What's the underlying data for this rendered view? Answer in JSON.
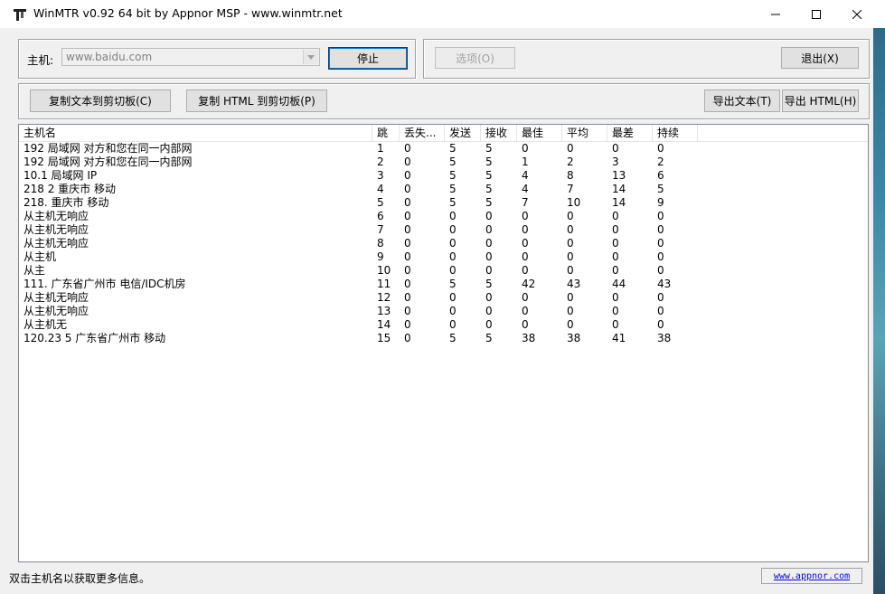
{
  "window": {
    "title": "WinMTR v0.92 64 bit by Appnor MSP - www.winmtr.net"
  },
  "host": {
    "label": "主机:",
    "value": "www.baidu.com"
  },
  "buttons": {
    "stop": "停止",
    "options": "选项(O)",
    "exit": "退出(X)",
    "copy_text": "复制文本到剪切板(C)",
    "copy_html": "复制 HTML 到剪切板(P)",
    "export_text": "导出文本(T)",
    "export_html": "导出 HTML(H)"
  },
  "table": {
    "columns": [
      "主机名",
      "跳",
      "丢失...",
      "发送",
      "接收",
      "最佳",
      "平均",
      "最差",
      "持续"
    ],
    "rows": [
      {
        "host": "192         局域网 对方和您在同一内部网",
        "hop": "1",
        "loss": "0",
        "sent": "5",
        "recv": "5",
        "best": "0",
        "avg": "0",
        "worst": "0",
        "last": "0"
      },
      {
        "host": "192         局域网 对方和您在同一内部网",
        "hop": "2",
        "loss": "0",
        "sent": "5",
        "recv": "5",
        "best": "1",
        "avg": "2",
        "worst": "3",
        "last": "2"
      },
      {
        "host": "10.1       局域网 IP",
        "hop": "3",
        "loss": "0",
        "sent": "5",
        "recv": "5",
        "best": "4",
        "avg": "8",
        "worst": "13",
        "last": "6"
      },
      {
        "host": "218          2 重庆市 移动",
        "hop": "4",
        "loss": "0",
        "sent": "5",
        "recv": "5",
        "best": "4",
        "avg": "7",
        "worst": "14",
        "last": "5"
      },
      {
        "host": "218.         重庆市 移动",
        "hop": "5",
        "loss": "0",
        "sent": "5",
        "recv": "5",
        "best": "7",
        "avg": "10",
        "worst": "14",
        "last": "9"
      },
      {
        "host": "从主机无响应",
        "hop": "6",
        "loss": "0",
        "sent": "0",
        "recv": "0",
        "best": "0",
        "avg": "0",
        "worst": "0",
        "last": "0"
      },
      {
        "host": "从主机无响应",
        "hop": "7",
        "loss": "0",
        "sent": "0",
        "recv": "0",
        "best": "0",
        "avg": "0",
        "worst": "0",
        "last": "0"
      },
      {
        "host": "从主机无响应",
        "hop": "8",
        "loss": "0",
        "sent": "0",
        "recv": "0",
        "best": "0",
        "avg": "0",
        "worst": "0",
        "last": "0"
      },
      {
        "host": "从主机",
        "hop": "9",
        "loss": "0",
        "sent": "0",
        "recv": "0",
        "best": "0",
        "avg": "0",
        "worst": "0",
        "last": "0"
      },
      {
        "host": "从主",
        "hop": "10",
        "loss": "0",
        "sent": "0",
        "recv": "0",
        "best": "0",
        "avg": "0",
        "worst": "0",
        "last": "0"
      },
      {
        "host": "111.          广东省广州市 电信/IDC机房",
        "hop": "11",
        "loss": "0",
        "sent": "5",
        "recv": "5",
        "best": "42",
        "avg": "43",
        "worst": "44",
        "last": "43"
      },
      {
        "host": "从主机无响应",
        "hop": "12",
        "loss": "0",
        "sent": "0",
        "recv": "0",
        "best": "0",
        "avg": "0",
        "worst": "0",
        "last": "0"
      },
      {
        "host": "从主机无响应",
        "hop": "13",
        "loss": "0",
        "sent": "0",
        "recv": "0",
        "best": "0",
        "avg": "0",
        "worst": "0",
        "last": "0"
      },
      {
        "host": "从主机无",
        "hop": "14",
        "loss": "0",
        "sent": "0",
        "recv": "0",
        "best": "0",
        "avg": "0",
        "worst": "0",
        "last": "0"
      },
      {
        "host": "120.23         5 广东省广州市 移动",
        "hop": "15",
        "loss": "0",
        "sent": "5",
        "recv": "5",
        "best": "38",
        "avg": "38",
        "worst": "41",
        "last": "38"
      }
    ]
  },
  "status": {
    "hint": "双击主机名以获取更多信息。",
    "link": "www.appnor.com"
  },
  "icons": {
    "app": "winmtr-app-icon",
    "minimize": "minimize-icon",
    "maximize": "maximize-icon",
    "close": "close-icon",
    "dropdown": "chevron-down-icon"
  }
}
